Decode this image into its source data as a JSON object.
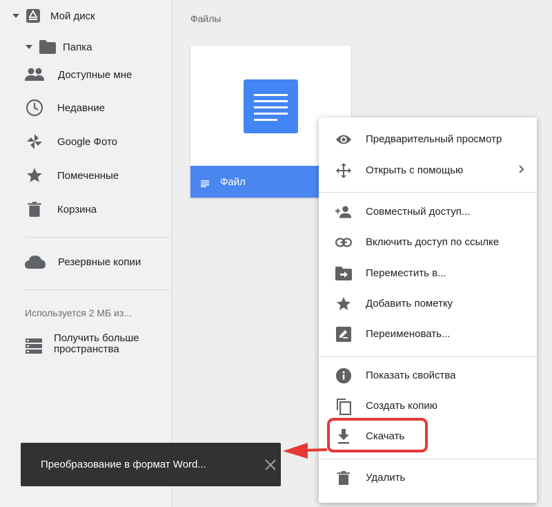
{
  "sidebar": {
    "my_drive": "Мой диск",
    "folder": "Папка",
    "items": [
      {
        "label": "Доступные мне",
        "icon": "people-icon"
      },
      {
        "label": "Недавние",
        "icon": "clock-icon"
      },
      {
        "label": "Google Фото",
        "icon": "pinwheel-icon"
      },
      {
        "label": "Помеченные",
        "icon": "star-icon"
      },
      {
        "label": "Корзина",
        "icon": "trash-icon"
      }
    ],
    "backups": "Резервные копии",
    "quota": "Используется 2 МБ из...",
    "more_storage_line1": "Получить больше",
    "more_storage_line2": "пространства"
  },
  "main": {
    "section_title": "Файлы",
    "file_name": "Файл"
  },
  "context_menu": {
    "preview": "Предварительный просмотр",
    "open_with": "Открыть с помощью",
    "share": "Совместный доступ...",
    "get_link": "Включить доступ по ссылке",
    "move_to": "Переместить в...",
    "add_star": "Добавить пометку",
    "rename": "Переименовать...",
    "details": "Показать свойства",
    "make_copy": "Создать копию",
    "download": "Скачать",
    "remove": "Удалить"
  },
  "toast": {
    "message": "Преобразование в формат Word..."
  },
  "colors": {
    "accent_blue": "#4285f4",
    "highlight_red": "#e53935",
    "toast_bg": "#323232",
    "icon_grey": "#616161"
  }
}
